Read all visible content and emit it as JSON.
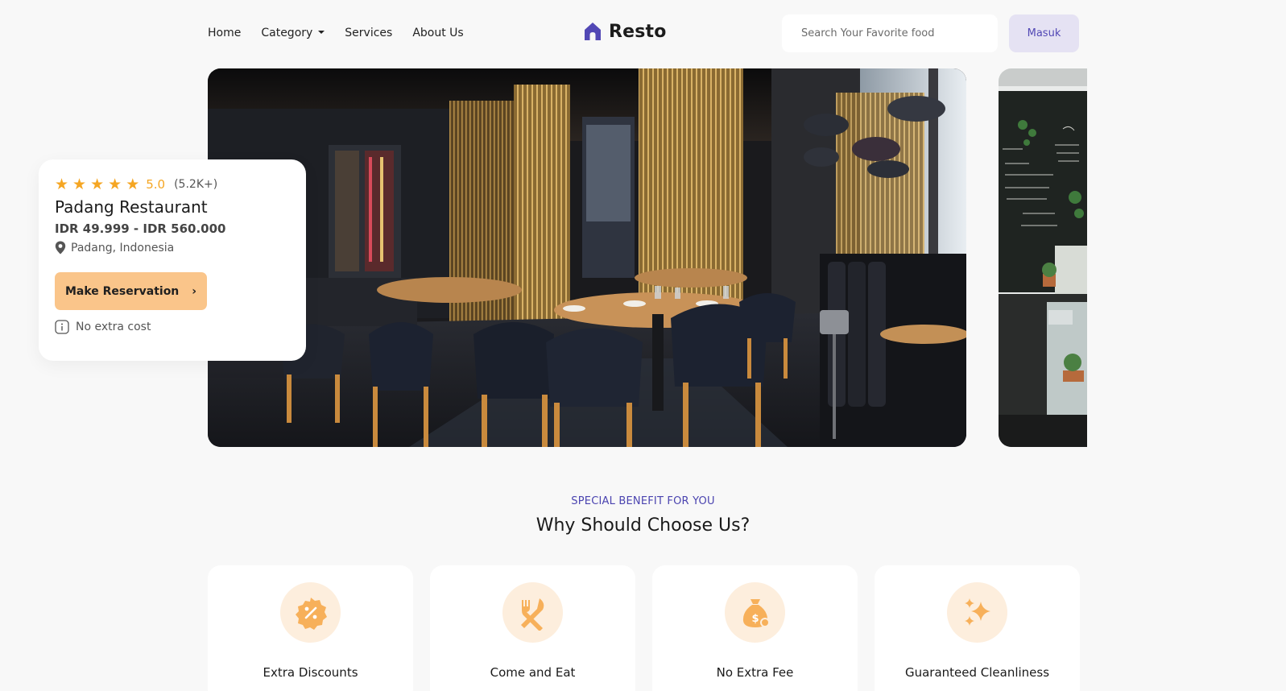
{
  "nav": {
    "links": [
      "Home",
      "Category",
      "Services",
      "About Us"
    ]
  },
  "brand": {
    "name": "Resto",
    "icon": "home-icon",
    "color": "#5248b5"
  },
  "search": {
    "placeholder": "Search Your Favorite food",
    "value": ""
  },
  "login": {
    "label": "Masuk"
  },
  "hero": {
    "main_image": "restaurant-interior-photo",
    "side_image": "cafe-chalkboard-photo"
  },
  "card": {
    "rating": "5.0",
    "rating_count": "(5.2K+)",
    "stars": 5,
    "name": "Padang Restaurant",
    "price": "IDR 49.999 - IDR 560.000",
    "location": "Padang, Indonesia",
    "button": "Make Reservation",
    "note": "No extra cost"
  },
  "benefits": {
    "eyebrow": "SPECIAL BENEFIT FOR YOU",
    "title": "Why Should Choose Us?",
    "items": [
      {
        "label": "Extra Discounts",
        "icon": "discount-badge-icon"
      },
      {
        "label": "Come and Eat",
        "icon": "fork-knife-icon"
      },
      {
        "label": "No Extra Fee",
        "icon": "money-bag-icon"
      },
      {
        "label": "Guaranteed Cleanliness",
        "icon": "sparkles-icon"
      }
    ]
  },
  "colors": {
    "accent": "#5248b5",
    "orange": "#fac58a",
    "star": "#f5a623",
    "bg": "#f8f8f8"
  }
}
